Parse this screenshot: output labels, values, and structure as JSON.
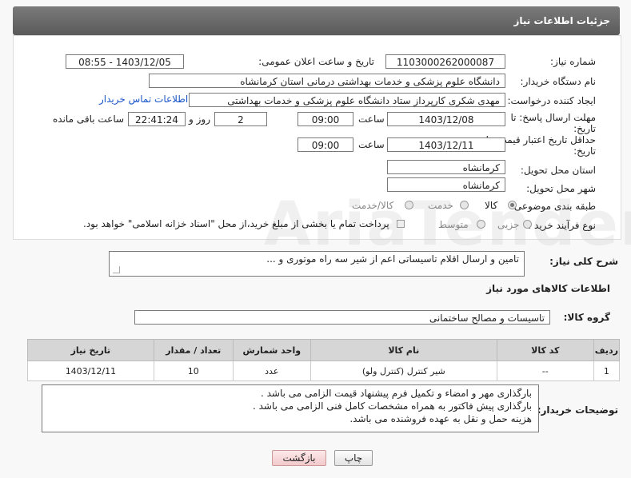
{
  "header": {
    "title": "جزئیات اطلاعات نیاز"
  },
  "form": {
    "need_number_label": "شماره نیاز:",
    "need_number": "1103000262000087",
    "announce_label": "تاریخ و ساعت اعلان عمومی:",
    "announce_value": "1403/12/05 - 08:55",
    "buyer_org_label": "نام دستگاه خریدار:",
    "buyer_org": "دانشگاه علوم پزشکی و خدمات بهداشتی  درمانی استان کرمانشاه",
    "creator_label": "ایجاد کننده درخواست:",
    "creator": "مهدی شکری کارپرداز ستاد دانشگاه علوم پزشکی و خدمات بهداشتی",
    "contact_link": "اطلاعات تماس خریدار",
    "reply_deadline_label_1": "مهلت ارسال پاسخ: تا",
    "reply_deadline_label_2": "تاریخ:",
    "reply_date": "1403/12/08",
    "time_label": "ساعت",
    "reply_time": "09:00",
    "days_value": "2",
    "days_label": "روز و",
    "remaining_time": "22:41:24",
    "remaining_label": "ساعت باقی مانده",
    "price_validity_label_1": "حداقل تاریخ اعتبار قیمت: تا",
    "price_validity_label_2": "تاریخ:",
    "validity_date": "1403/12/11",
    "validity_time_label": "ساعت",
    "validity_time": "09:00",
    "province_label": "استان محل تحویل:",
    "province": "کرمانشاه",
    "city_label": "شهر محل تحویل:",
    "city": "کرمانشاه",
    "category_label": "طبقه بندی موضوعی:",
    "category_options": [
      "کالا",
      "خدمت",
      "کالا/خدمت"
    ],
    "category_selected": "کالا",
    "process_label": "نوع فرآیند خرید :",
    "process_options": [
      "جزیی",
      "متوسط"
    ],
    "payment_note": "پرداخت تمام یا بخشی از مبلغ خرید،از محل \"اسناد خزانه اسلامی\" خواهد بود."
  },
  "description": {
    "label": "شرح کلی نیاز:",
    "text": "تامین و ارسال اقلام تاسیساتی اعم از شیر سه راه موتوری و ..."
  },
  "goods": {
    "section_title": "اطلاعات کالاهای مورد نیاز",
    "group_label": "گروه کالا:",
    "group_value": "تاسیسات و مصالح ساختمانی",
    "columns": [
      "ردیف",
      "کد کالا",
      "نام کالا",
      "واحد شمارش",
      "تعداد / مقدار",
      "تاریخ نیاز"
    ],
    "rows": [
      [
        "1",
        "--",
        "شیر کنترل (کنترل ولو)",
        "عدد",
        "10",
        "1403/12/11"
      ]
    ]
  },
  "buyer_notes": {
    "label": "توضیحات خریدار:",
    "lines": [
      "بارگذاری مهر و امضاء و تکمیل فرم پیشنهاد قیمت الزامی می باشد .",
      "بارگذاری پیش فاکتور به همراه مشخصات کامل فنی الزامی می باشد .",
      "هزینه حمل و نقل به عهده فروشنده می باشد."
    ]
  },
  "buttons": {
    "print": "چاپ",
    "back": "بازگشت"
  },
  "watermark": "AriaTender.neT"
}
